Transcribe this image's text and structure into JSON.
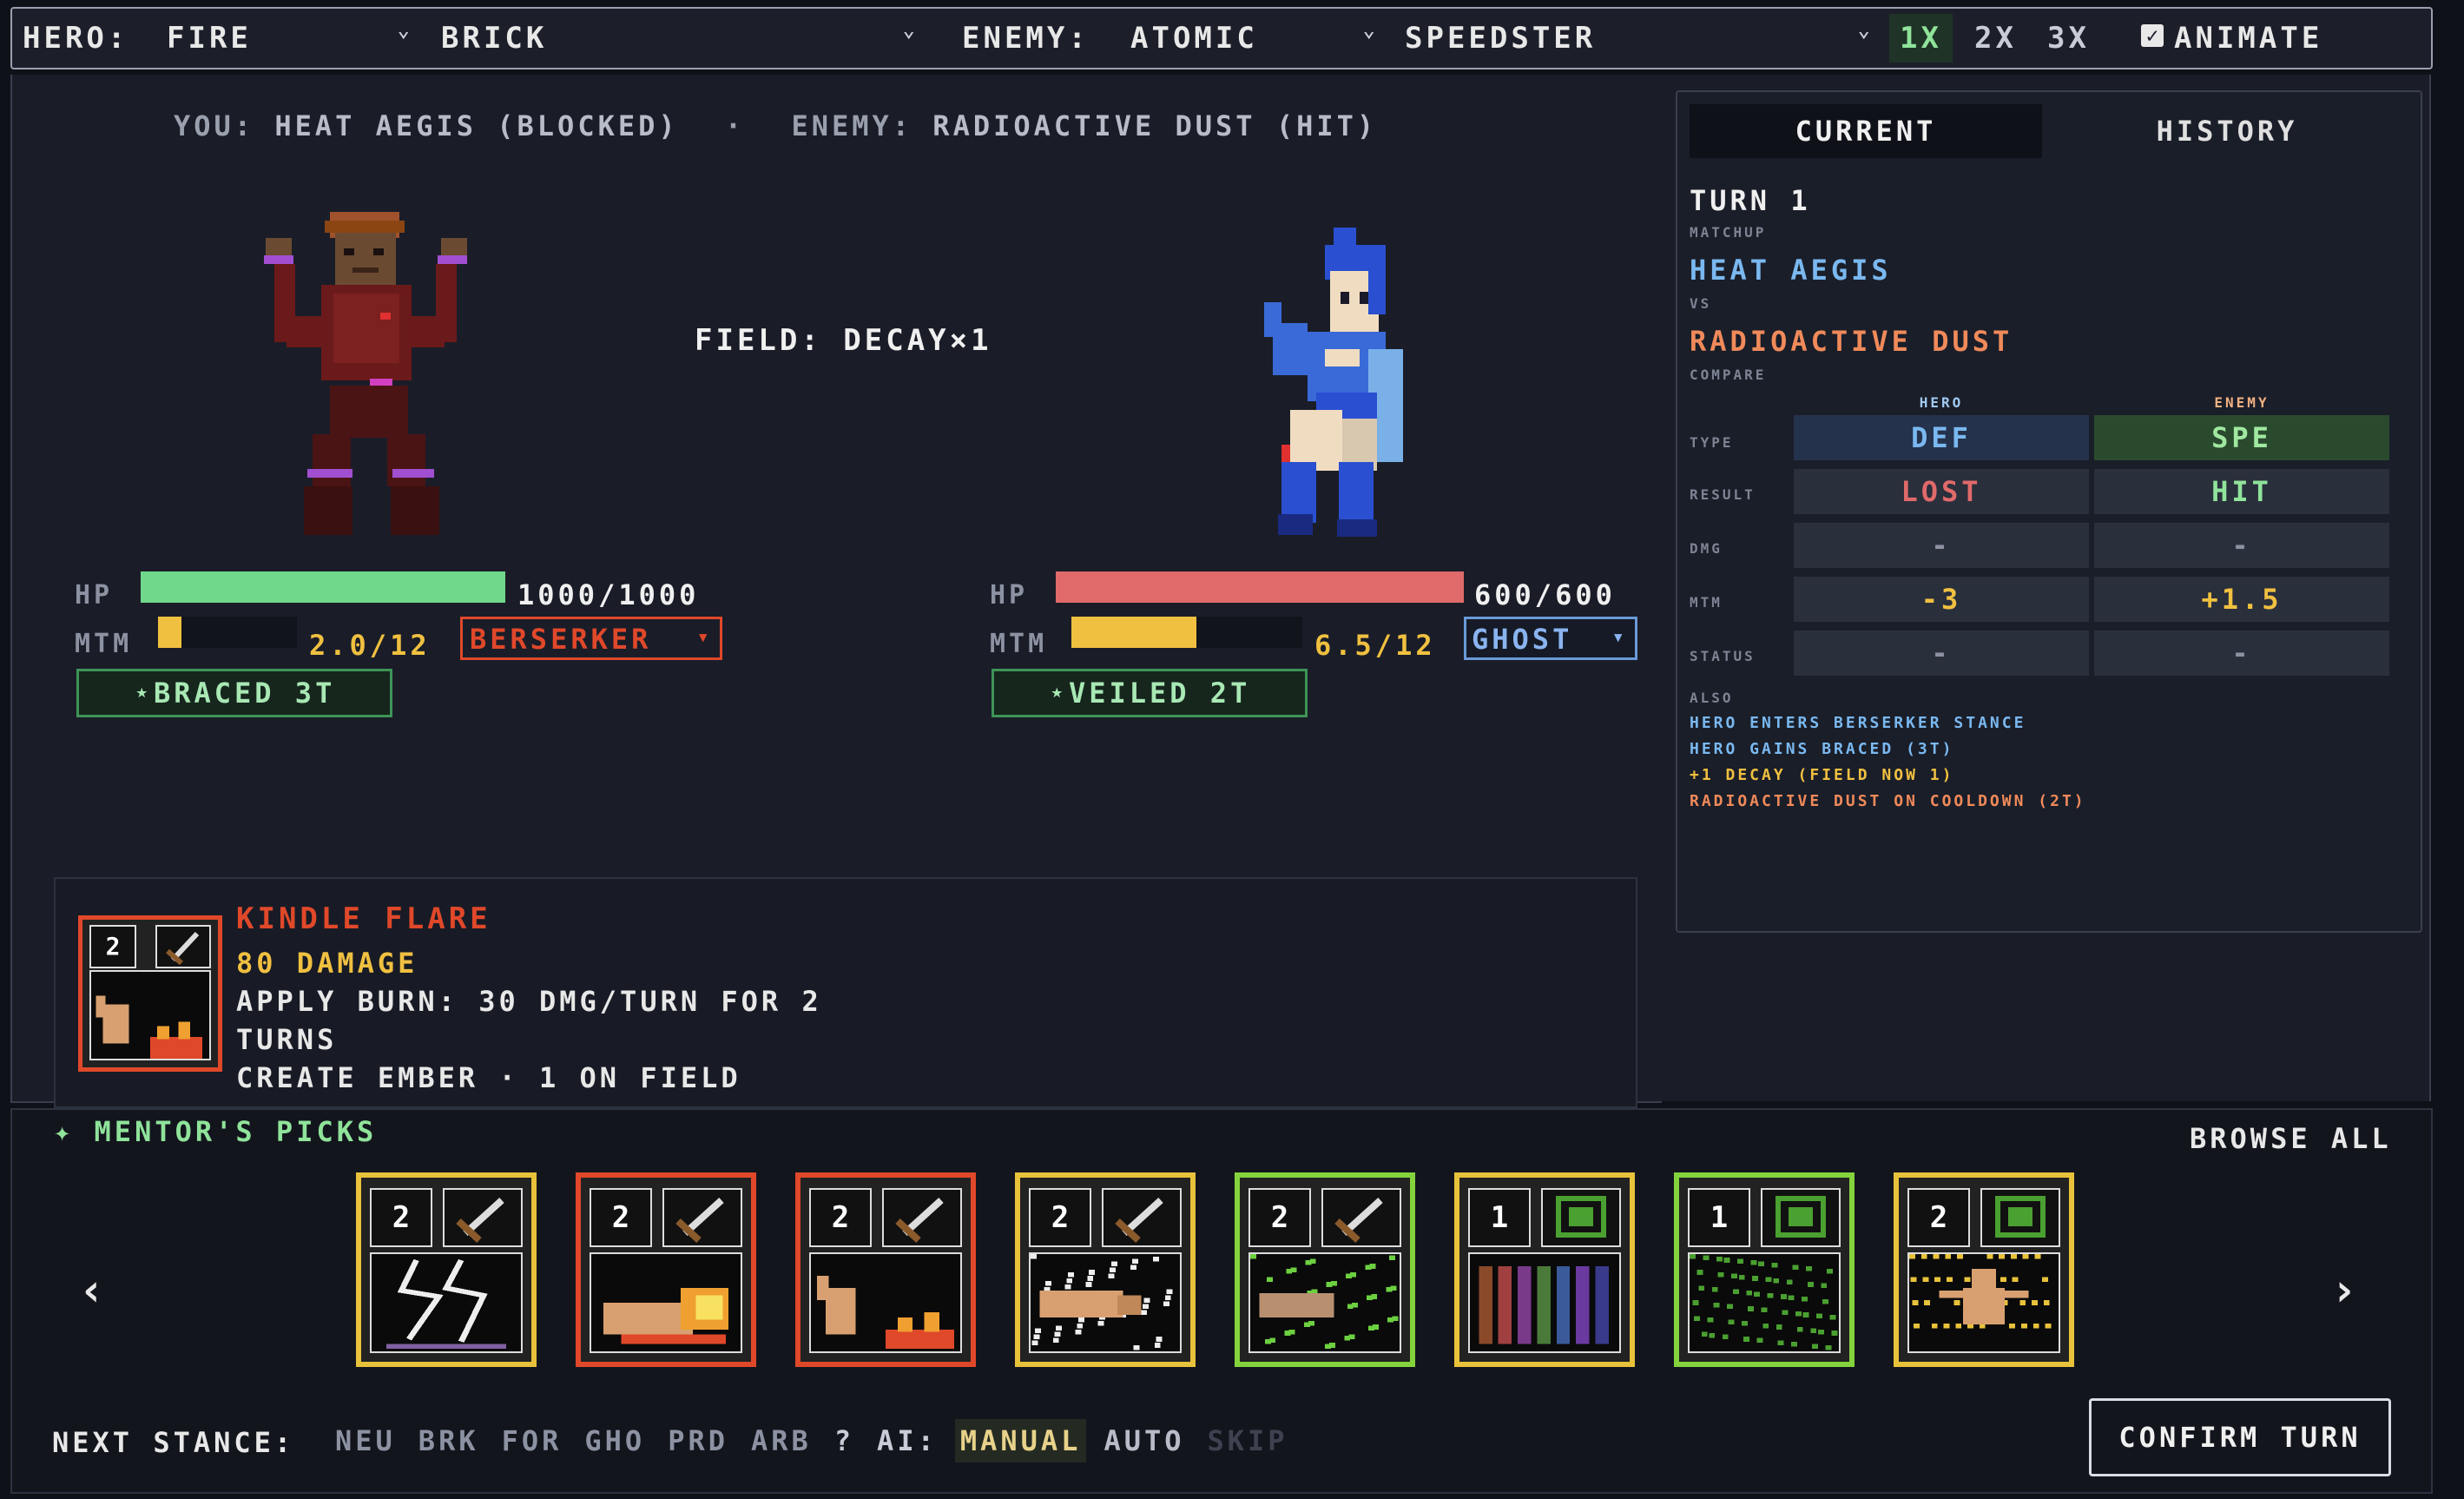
{
  "topbar": {
    "hero_label": "HERO:",
    "hero_type": "FIRE",
    "hero_stance": "BRICK",
    "enemy_label": "ENEMY:",
    "enemy_type": "ATOMIC",
    "enemy_stance": "SPEEDSTER",
    "speeds": [
      "1X",
      "2X",
      "3X"
    ],
    "speed_selected": "1X",
    "animate_label": "ANIMATE",
    "animate_checked": true,
    "check_glyph": "✓",
    "chevron_glyph": "⌄"
  },
  "battle": {
    "log_you_label": "YOU:",
    "log_you_move": "HEAT AEGIS (BLOCKED)",
    "log_sep": "·",
    "log_enemy_label": "ENEMY:",
    "log_enemy_move": "RADIOACTIVE DUST (HIT)",
    "field_text": "FIELD: DECAY×1",
    "hero": {
      "hp_label": "HP",
      "hp_value": "1000/1000",
      "hp_fraction": 1.0,
      "mtm_label": "MTM",
      "mtm_value": "2.0/12",
      "mtm_fraction": 0.167,
      "stance_select": "BERSERKER",
      "status_badge": "⋆BRACED 3T",
      "hp_color": "#6fd88a",
      "mtm_color": "#f0c040"
    },
    "enemy": {
      "hp_label": "HP",
      "hp_value": "600/600",
      "hp_fraction": 1.0,
      "mtm_label": "MTM",
      "mtm_value": "6.5/12",
      "mtm_fraction": 0.542,
      "stance_select": "GHOST",
      "status_badge": "⋆VEILED 2T",
      "hp_color": "#e06a6a",
      "mtm_color": "#f0c040"
    },
    "dropdown_arrow": "▾"
  },
  "card_detail": {
    "name": "KINDLE FLARE",
    "damage": "80 DAMAGE",
    "line1": "APPLY BURN: 30 DMG/TURN FOR 2",
    "line2": "TURNS",
    "line3": "CREATE EMBER · 1 ON FIELD",
    "cost": "2"
  },
  "side": {
    "tabs": [
      "CURRENT",
      "HISTORY"
    ],
    "turn": "TURN 1",
    "matchup_label": "MATCHUP",
    "hero_move": "HEAT AEGIS",
    "vs_label": "VS",
    "enemy_move": "RADIOACTIVE DUST",
    "compare_label": "COMPARE",
    "col_hero": "HERO",
    "col_enemy": "ENEMY",
    "rows": [
      {
        "label": "TYPE",
        "hero": "DEF",
        "enemy": "SPE"
      },
      {
        "label": "RESULT",
        "hero": "LOST",
        "enemy": "HIT"
      },
      {
        "label": "DMG",
        "hero": "-",
        "enemy": "-"
      },
      {
        "label": "MTM",
        "hero": "-3",
        "enemy": "+1.5"
      },
      {
        "label": "STATUS",
        "hero": "-",
        "enemy": "-"
      }
    ],
    "also_label": "ALSO",
    "also": [
      "HERO ENTERS BERSERKER STANCE",
      "HERO GAINS BRACED (3T)",
      "+1 DECAY (FIELD NOW 1)",
      "RADIOACTIVE DUST ON COOLDOWN (2T)"
    ]
  },
  "picks": {
    "title": "✦ MENTOR'S PICKS",
    "browse_all": "BROWSE ALL",
    "prev": "‹",
    "next": "›",
    "cards": [
      {
        "cost": "2",
        "tag": "attack",
        "art": "lightning",
        "border": "#e8c23a"
      },
      {
        "cost": "2",
        "tag": "attack",
        "art": "fire-fist",
        "border": "#e0482a"
      },
      {
        "cost": "2",
        "tag": "attack",
        "art": "hand-flame",
        "border": "#e0482a"
      },
      {
        "cost": "2",
        "tag": "attack",
        "art": "punch-static",
        "border": "#e8c23a"
      },
      {
        "cost": "2",
        "tag": "attack",
        "art": "punch-green",
        "border": "#84d33c"
      },
      {
        "cost": "1",
        "tag": "shield",
        "art": "bars",
        "border": "#e8c23a"
      },
      {
        "cost": "1",
        "tag": "shield",
        "art": "green-static",
        "border": "#84d33c"
      },
      {
        "cost": "2",
        "tag": "shield",
        "art": "figure-static",
        "border": "#e8c23a"
      }
    ]
  },
  "controls": {
    "next_stance_label": "NEXT STANCE:",
    "stances": [
      "NEU",
      "BRK",
      "FOR",
      "GHO",
      "PRD",
      "ARB"
    ],
    "help": "?",
    "ai_label": "AI:",
    "ai_modes": [
      "MANUAL",
      "AUTO",
      "SKIP"
    ],
    "ai_selected": "MANUAL",
    "confirm": "CONFIRM TURN"
  }
}
